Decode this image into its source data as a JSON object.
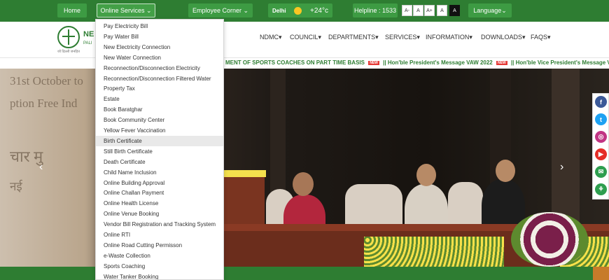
{
  "topbar": {
    "home": "Home",
    "online_services": "Online Services ⌄",
    "employee_corner": "Employee Corner ⌄",
    "weather": {
      "city": "Delhi",
      "temp": "+24°c"
    },
    "helpline": "Helpline : 1533",
    "font_sizes": [
      "A-",
      "A",
      "A+",
      "A",
      "A"
    ],
    "language": "Language⌄"
  },
  "header": {
    "logo_text": "NE",
    "logo_sub": "PALI",
    "logo_tag": "जो दिल्ली जनहित",
    "nav": [
      "NDMC▾",
      "COUNCIL▾",
      "DEPARTMENTS▾",
      "SERVICES▾",
      "INFORMATION▾",
      "DOWNLOADS▾",
      "FAQS▾"
    ]
  },
  "ticker": {
    "text1": "MENT OF SPORTS COACHES ON PART TIME BASIS",
    "text2": "|| Hon'ble President's Message VAW 2022",
    "text3": "|| Hon'ble Vice President's Message VAW",
    "badge": "NEW"
  },
  "hero": {
    "wall_text": [
      "31st October to",
      "ption Free Ind",
      "चार मु",
      "नई"
    ],
    "prev": "‹",
    "next": "›",
    "slide_count": 7,
    "active_slide": 2
  },
  "social": [
    {
      "icon": "facebook-icon",
      "glyph": "f",
      "color": "#3b5998"
    },
    {
      "icon": "twitter-icon",
      "glyph": "t",
      "color": "#1da1f2"
    },
    {
      "icon": "instagram-icon",
      "glyph": "◎",
      "color": "#c13584"
    },
    {
      "icon": "youtube-icon",
      "glyph": "▶",
      "color": "#e52d27"
    },
    {
      "icon": "email-icon",
      "glyph": "✉",
      "color": "#2e9e4f"
    },
    {
      "icon": "sitemap-icon",
      "glyph": "⚘",
      "color": "#2e9e4f"
    }
  ],
  "dropdown": {
    "items": [
      "Pay Electricity Bill",
      "Pay Water Bill",
      "New Electricity Connection",
      "New Water Connection",
      "Reconnection/Disconnection Electricity",
      "Reconnection/Disconnection Filtered Water",
      "Property Tax",
      "Estate",
      "Book Baratghar",
      "Book Community Center",
      "Yellow Fever Vaccination",
      "Birth Certificate",
      "Still Birth Certificate",
      "Death Certificate",
      "Child Name Inclusion",
      "Online Building Approval",
      "Online Challan Payment",
      "Online Health License",
      "Online Venue Booking",
      "Vendor Bill Registration and Tracking System",
      "Online RTI",
      "Online Road Cutting Permisson",
      "e-Waste Collection",
      "Sports Coaching",
      "Water Tanker Booking"
    ],
    "highlighted": "Birth Certificate"
  },
  "colors": {
    "primary_green": "#2e7d32",
    "accent_orange": "#c77b2a"
  }
}
